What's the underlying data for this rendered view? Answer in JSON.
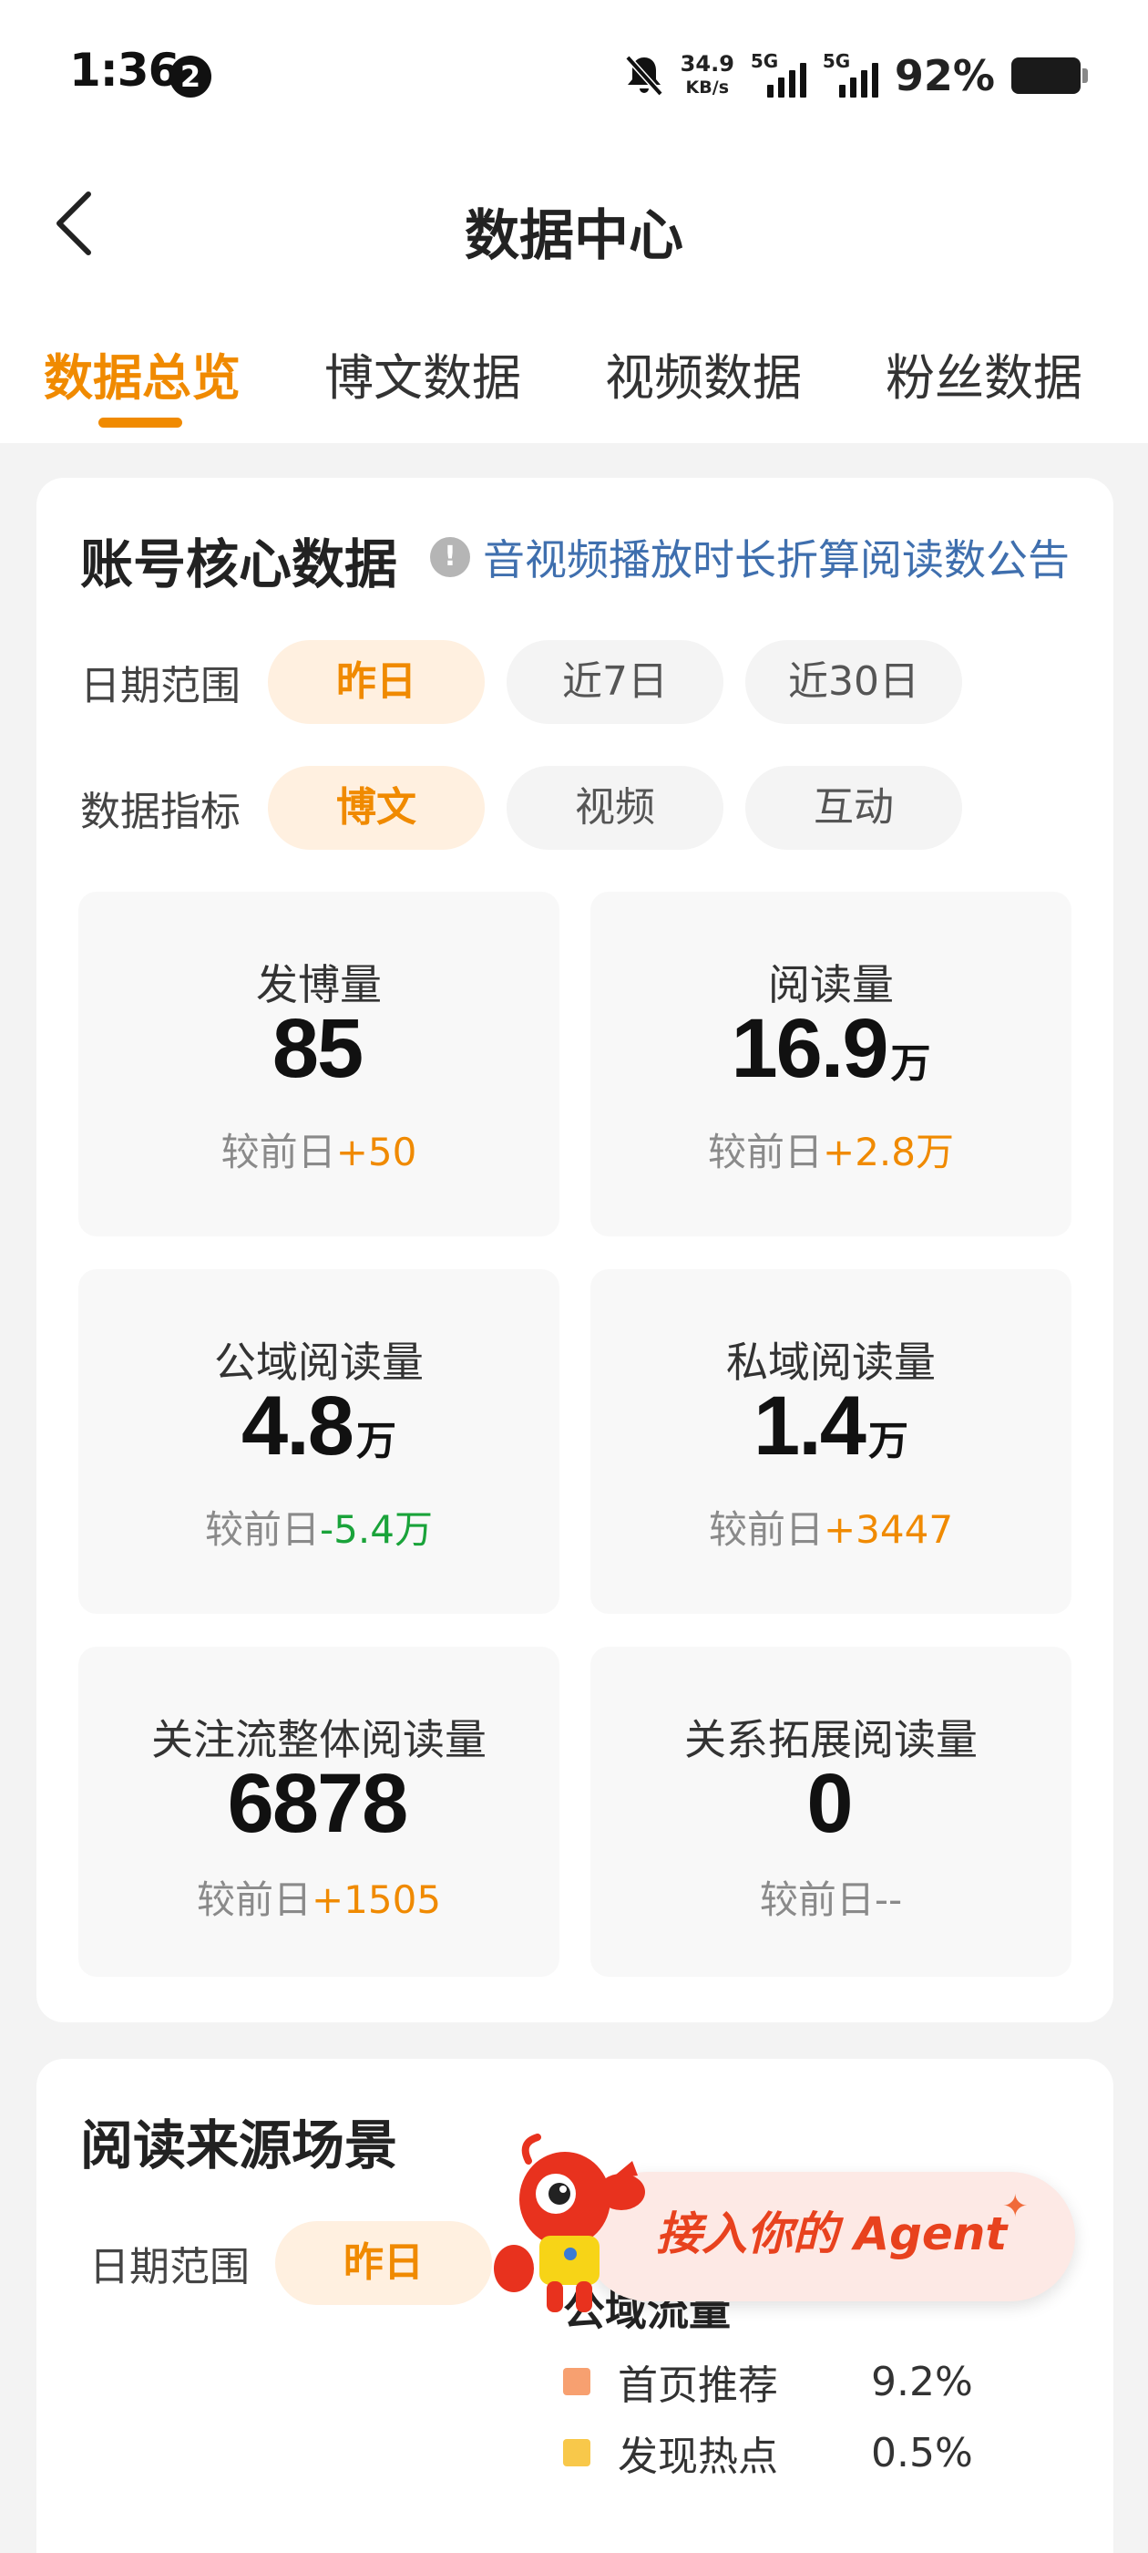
{
  "status_bar": {
    "time": "1:36",
    "notification_count": "2",
    "net_speed_value": "34.9",
    "net_speed_unit": "KB/s",
    "sim1": "5G",
    "sim2": "5G",
    "battery": "92%"
  },
  "nav": {
    "title": "数据中心"
  },
  "tabs": [
    {
      "label": "数据总览",
      "active": true
    },
    {
      "label": "博文数据",
      "active": false
    },
    {
      "label": "视频数据",
      "active": false
    },
    {
      "label": "粉丝数据",
      "active": false
    }
  ],
  "core": {
    "title": "账号核心数据",
    "notice": "音视频播放时长折算阅读数公告",
    "date_label": "日期范围",
    "date_options": [
      "昨日",
      "近7日",
      "近30日"
    ],
    "metric_label": "数据指标",
    "metric_options": [
      "博文",
      "视频",
      "互动"
    ],
    "metrics": [
      {
        "label": "发博量",
        "value": "85",
        "unit": "",
        "cmp_prefix": "较前日",
        "cmp_value": "+50",
        "trend": "up"
      },
      {
        "label": "阅读量",
        "value": "16.9",
        "unit": "万",
        "cmp_prefix": "较前日",
        "cmp_value": "+2.8万",
        "trend": "up"
      },
      {
        "label": "公域阅读量",
        "value": "4.8",
        "unit": "万",
        "cmp_prefix": "较前日",
        "cmp_value": "-5.4万",
        "trend": "down"
      },
      {
        "label": "私域阅读量",
        "value": "1.4",
        "unit": "万",
        "cmp_prefix": "较前日",
        "cmp_value": "+3447",
        "trend": "up"
      },
      {
        "label": "关注流整体阅读量",
        "value": "6878",
        "unit": "",
        "cmp_prefix": "较前日",
        "cmp_value": "+1505",
        "trend": "up"
      },
      {
        "label": "关系拓展阅读量",
        "value": "0",
        "unit": "",
        "cmp_prefix": "较前日",
        "cmp_value": "--",
        "trend": "none"
      }
    ]
  },
  "source": {
    "title": "阅读来源场景",
    "date_label": "日期范围",
    "date_selected": "昨日",
    "legend_title": "公域流量",
    "legend": [
      {
        "name": "首页推荐",
        "value": "9.2%",
        "color": "#f7a070"
      },
      {
        "name": "发现热点",
        "value": "0.5%",
        "color": "#f8c84a"
      }
    ]
  },
  "agent": {
    "label": "接入你的 Agent"
  },
  "colors": {
    "accent": "#f08a00",
    "link": "#3f6fae",
    "down": "#1aa33a"
  }
}
